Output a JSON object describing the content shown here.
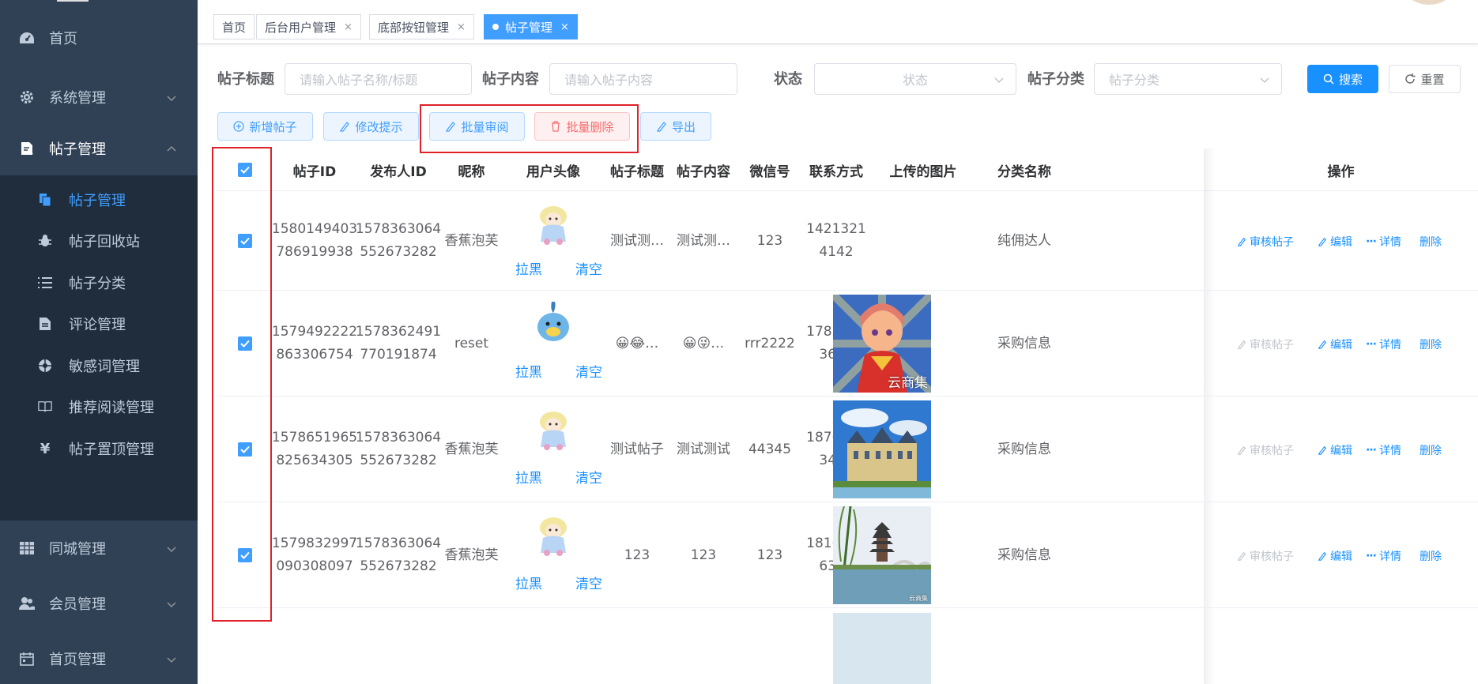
{
  "sidebar": {
    "items": [
      {
        "label": "首页",
        "icon": "dashboard-icon"
      },
      {
        "label": "系统管理",
        "icon": "gear-icon"
      },
      {
        "label": "帖子管理",
        "icon": "post-icon"
      },
      {
        "label": "同城管理",
        "icon": "table-icon"
      },
      {
        "label": "会员管理",
        "icon": "users-icon"
      },
      {
        "label": "首页管理",
        "icon": "calendar-icon"
      }
    ],
    "sub_items": [
      {
        "label": "帖子管理",
        "icon": "documents-icon"
      },
      {
        "label": "帖子回收站",
        "icon": "bug-icon"
      },
      {
        "label": "帖子分类",
        "icon": "list-icon"
      },
      {
        "label": "评论管理",
        "icon": "document-icon"
      },
      {
        "label": "敏感词管理",
        "icon": "aperture-icon"
      },
      {
        "label": "推荐阅读管理",
        "icon": "book-icon"
      },
      {
        "label": "帖子置顶管理",
        "icon": "yen-icon"
      }
    ]
  },
  "tags": [
    {
      "label": "首页"
    },
    {
      "label": "后台用户管理",
      "close": "×"
    },
    {
      "label": "底部按钮管理",
      "close": "×"
    },
    {
      "label": "帖子管理",
      "close": "×"
    }
  ],
  "search": {
    "title_label": "帖子标题",
    "title_placeholder": "请输入帖子名称/标题",
    "content_label": "帖子内容",
    "content_placeholder": "请输入帖子内容",
    "status_label": "状态",
    "status_placeholder": "状态",
    "category_label": "帖子分类",
    "category_placeholder": "帖子分类",
    "search_button": "搜索",
    "reset_button": "重置"
  },
  "toolbar": {
    "add": "新增帖子",
    "edit_tip": "修改提示",
    "batch_review": "批量审阅",
    "batch_delete": "批量删除",
    "export": "导出"
  },
  "table": {
    "headers": [
      "帖子ID",
      "发布人ID",
      "昵称",
      "用户头像",
      "帖子标题",
      "帖子内容",
      "微信号",
      "联系方式",
      "上传的图片",
      "分类名称",
      "操作"
    ],
    "avatar_actions": {
      "block": "拉黑",
      "clear": "清空"
    },
    "ops": {
      "review": "审核帖子",
      "edit": "编辑",
      "detail": "详情",
      "delete": "删除"
    },
    "rows": [
      {
        "id": [
          "1580149403",
          "786919938"
        ],
        "publisher": [
          "1578363064",
          "552673282"
        ],
        "nickname": "香蕉泡芙",
        "avatar": "sheep",
        "title": "测试测…",
        "content": "测试测…",
        "wechat": "123",
        "phone": [
          "1421321",
          "4142"
        ],
        "image": "",
        "image_watermark": "",
        "category": "纯佣达人",
        "review_enabled": true
      },
      {
        "id": [
          "1579492222",
          "863306754"
        ],
        "publisher": [
          "1578362491",
          "770191874"
        ],
        "nickname": "reset",
        "avatar": "bird",
        "title": "😀😂…",
        "content": "😀😜…",
        "wechat": "rrr2222",
        "phone": [
          "1782580",
          "3690"
        ],
        "image": "anime",
        "image_watermark": "云商集",
        "category": "采购信息",
        "review_enabled": false
      },
      {
        "id": [
          "1578651965",
          "825634305"
        ],
        "publisher": [
          "1578363064",
          "552673282"
        ],
        "nickname": "香蕉泡芙",
        "avatar": "sheep",
        "title": "测试帖子",
        "content": "测试测试",
        "wechat": "44345",
        "phone": [
          "1876545",
          "3413"
        ],
        "image": "castle",
        "image_watermark": "",
        "category": "采购信息",
        "review_enabled": false
      },
      {
        "id": [
          "1579832997",
          "090308097"
        ],
        "publisher": [
          "1578363064",
          "552673282"
        ],
        "nickname": "香蕉泡芙",
        "avatar": "sheep",
        "title": "123",
        "content": "123",
        "wechat": "123",
        "phone": [
          "1816545",
          "6341"
        ],
        "image": "pagoda",
        "image_watermark": "云商集",
        "category": "采购信息",
        "review_enabled": false
      }
    ]
  },
  "colors": {
    "sidebar_bg": "#304156",
    "submenu_bg": "#1f2d3d",
    "primary": "#1890ff",
    "danger": "#f56c6c",
    "highlight_box": "#e0212a"
  }
}
